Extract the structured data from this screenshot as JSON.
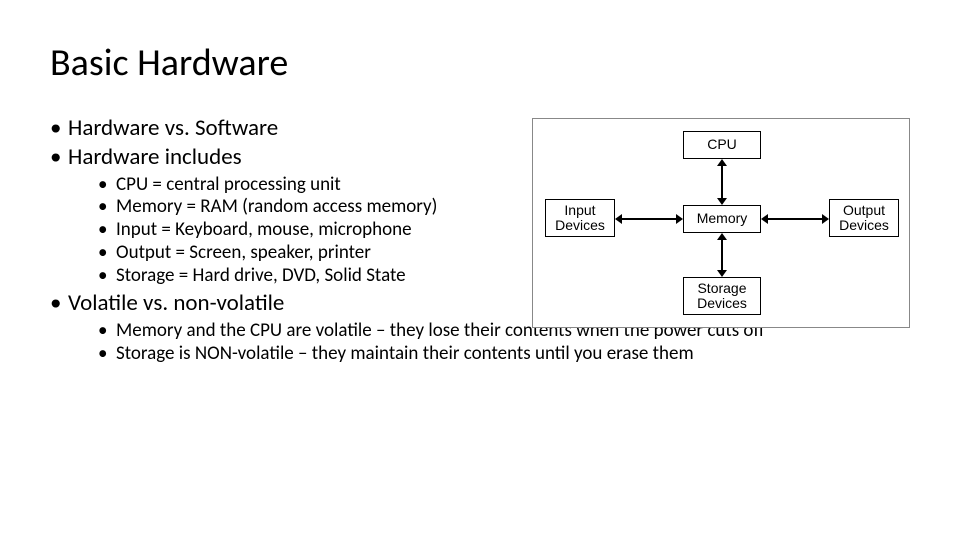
{
  "title": "Basic Hardware",
  "bullets": {
    "l1_0": "Hardware vs. Software",
    "l1_1": "Hardware includes",
    "l2_hw": {
      "i0": "CPU = central processing unit",
      "i1": "Memory = RAM (random access memory)",
      "i2": "Input = Keyboard, mouse, microphone",
      "i3": "Output = Screen, speaker, printer",
      "i4": "Storage = Hard drive, DVD, Solid State"
    },
    "l1_2": "Volatile vs. non-volatile",
    "l2_vol": {
      "i0": "Memory and the CPU are volatile – they lose their contents when the power cuts off",
      "i1": "Storage is NON-volatile – they maintain their contents until you erase them"
    }
  },
  "diagram": {
    "cpu": "CPU",
    "memory": "Memory",
    "storage": "Storage Devices",
    "input": "Input Devices",
    "output": "Output Devices"
  }
}
